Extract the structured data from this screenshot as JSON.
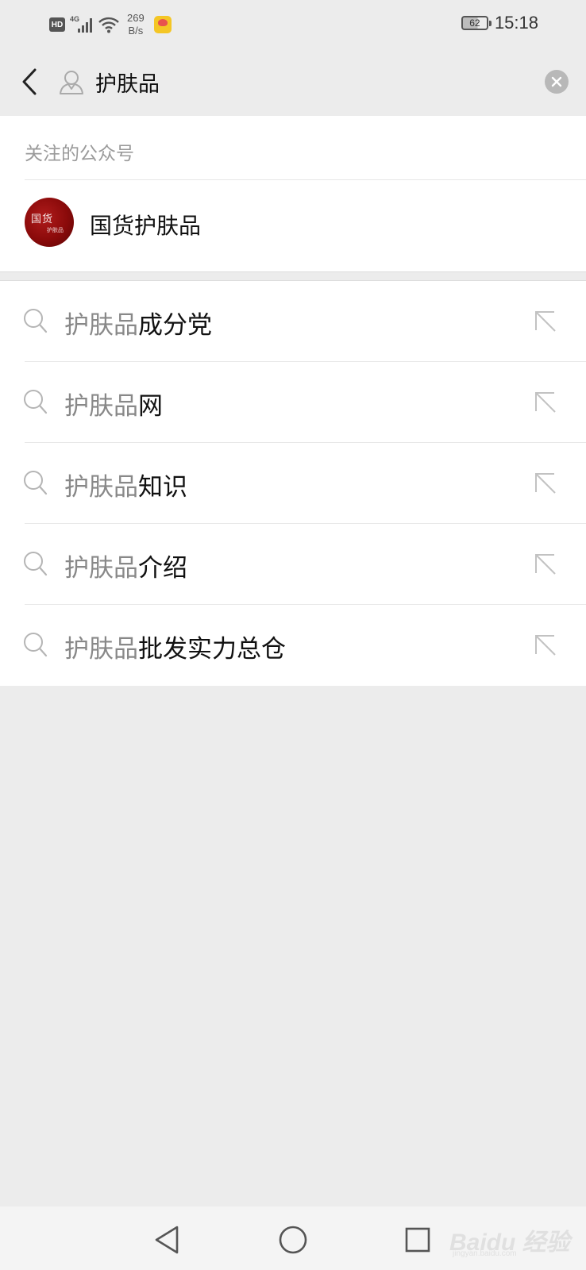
{
  "status_bar": {
    "hd": "HD",
    "network": "4G",
    "net_speed_value": "269",
    "net_speed_unit": "B/s",
    "battery": "62",
    "time": "15:18"
  },
  "search": {
    "query": "护肤品"
  },
  "accounts_section": {
    "title": "关注的公众号",
    "items": [
      {
        "name": "国货护肤品",
        "avatar_text_main": "国货",
        "avatar_text_sub": "护肤品"
      }
    ]
  },
  "suggestions": [
    {
      "query": "护肤品",
      "completion": "成分党"
    },
    {
      "query": "护肤品",
      "completion": "网"
    },
    {
      "query": "护肤品",
      "completion": "知识"
    },
    {
      "query": "护肤品",
      "completion": "介绍"
    },
    {
      "query": "护肤品",
      "completion": "批发实力总仓"
    }
  ],
  "watermark": {
    "brand": "Baidu 经验",
    "domain": "jingyan.baidu.com"
  },
  "icons": {
    "back": "chevron-left-icon",
    "contact": "contact-person-icon",
    "clear": "clear-icon",
    "suggestion": "search-icon",
    "fill": "arrow-up-left-icon",
    "nav_back": "triangle-back-icon",
    "nav_home": "circle-home-icon",
    "nav_recents": "square-recents-icon"
  },
  "colors": {
    "background": "#ececec",
    "card": "#ffffff",
    "muted_text": "#888888",
    "section_title": "#9a9a9a",
    "avatar": "#8a0a0a"
  }
}
